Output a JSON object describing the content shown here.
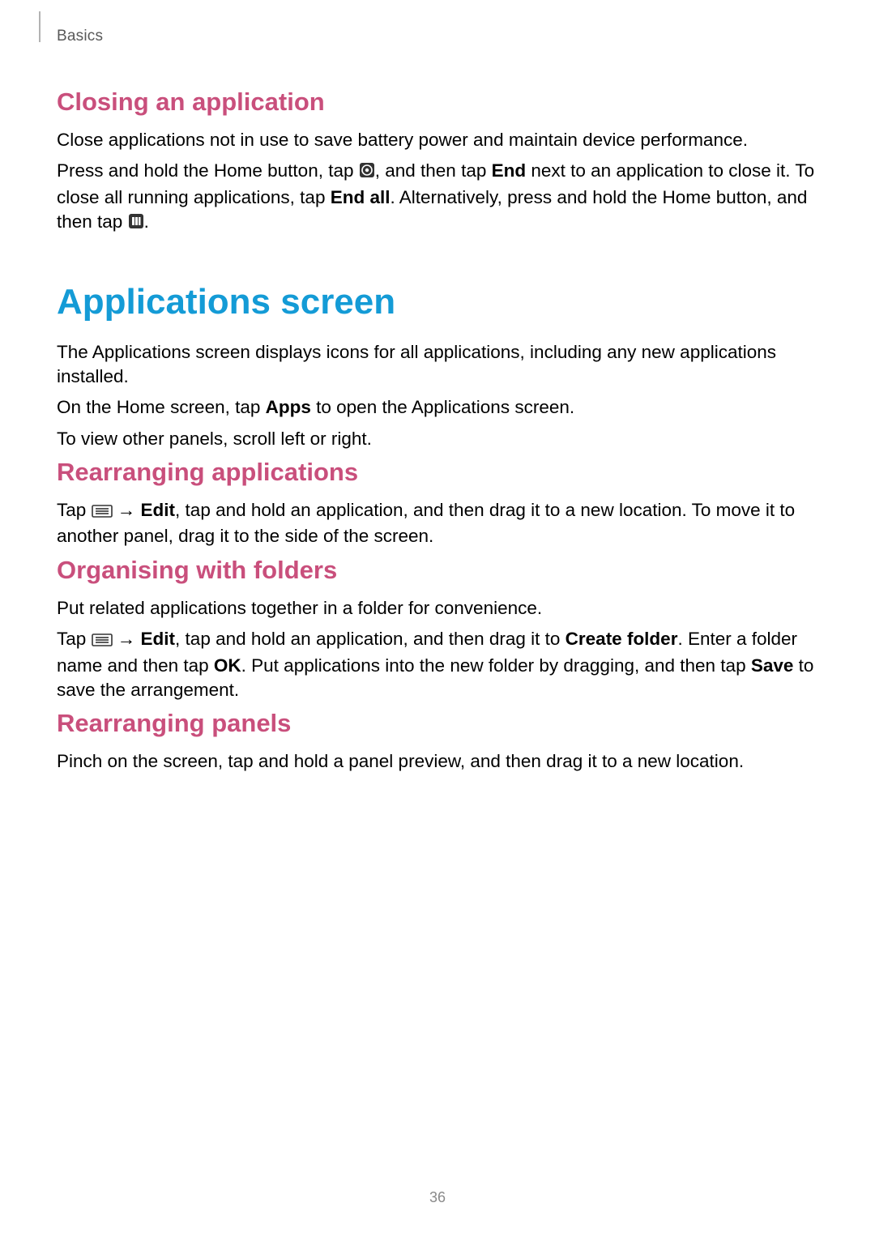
{
  "header": {
    "section": "Basics"
  },
  "s1": {
    "title": "Closing an application",
    "p1": "Close applications not in use to save battery power and maintain device performance.",
    "p2a": "Press and hold the Home button, tap ",
    "p2b": ", and then tap ",
    "p2_bold1": "End",
    "p2c": " next to an application to close it. To close all running applications, tap ",
    "p2_bold2": "End all",
    "p2d": ". Alternatively, press and hold the Home button, and then tap ",
    "p2e": "."
  },
  "s2": {
    "title": "Applications screen",
    "p1": "The Applications screen displays icons for all applications, including any new applications installed.",
    "p2a": "On the Home screen, tap ",
    "p2_bold1": "Apps",
    "p2b": " to open the Applications screen.",
    "p3": "To view other panels, scroll left or right."
  },
  "s3": {
    "title": "Rearranging applications",
    "p1a": "Tap ",
    "arrow": " → ",
    "p1_bold1": "Edit",
    "p1b": ", tap and hold an application, and then drag it to a new location. To move it to another panel, drag it to the side of the screen."
  },
  "s4": {
    "title": "Organising with folders",
    "p1": "Put related applications together in a folder for convenience.",
    "p2a": "Tap ",
    "arrow": " → ",
    "p2_bold1": "Edit",
    "p2b": ", tap and hold an application, and then drag it to ",
    "p2_bold2": "Create folder",
    "p2c": ". Enter a folder name and then tap ",
    "p2_bold3": "OK",
    "p2d": ". Put applications into the new folder by dragging, and then tap ",
    "p2_bold4": "Save",
    "p2e": " to save the arrangement."
  },
  "s5": {
    "title": "Rearranging panels",
    "p1": "Pinch on the screen, tap and hold a panel preview, and then drag it to a new location."
  },
  "page": "36"
}
